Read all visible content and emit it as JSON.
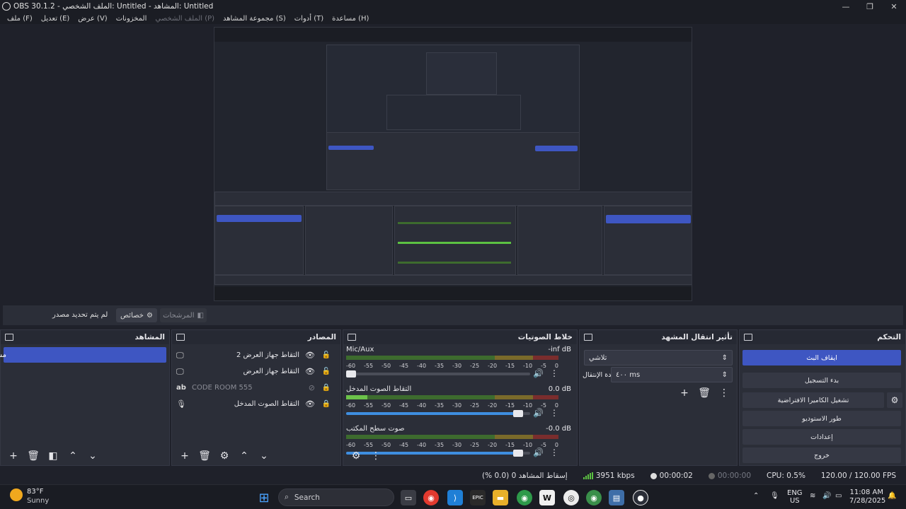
{
  "window": {
    "title": "OBS 30.1.2 - الملف الشخصي: Untitled - المشاهد: Untitled",
    "minimize": "—",
    "maximize": "❐",
    "close": "✕"
  },
  "menu": [
    {
      "label": "ملف (F)"
    },
    {
      "label": "تعديل (E)"
    },
    {
      "label": "عرض (V)"
    },
    {
      "label": "المخزونات"
    },
    {
      "label": "الملف الشخصي (P)",
      "disabled": true
    },
    {
      "label": "مجموعة المشاهد (S)"
    },
    {
      "label": "أدوات (T)"
    },
    {
      "label": "مساعدة (H)"
    }
  ],
  "source_toolbar": {
    "no_source": "لم يتم تحديد مصدر",
    "properties": "خصائص",
    "filters": "المرشحات"
  },
  "scenes": {
    "title": "المشاهد",
    "items": [
      "مشهد"
    ]
  },
  "sources": {
    "title": "المصادر",
    "items": [
      {
        "label": "التقاط جهاز العرض 2",
        "icon": "monitor-icon"
      },
      {
        "label": "التقاط جهاز العرض",
        "icon": "monitor-icon"
      },
      {
        "label": "CODE ROOM 555",
        "icon": "text-icon",
        "hidden": true
      },
      {
        "label": "التقاط الصوت المدخل",
        "icon": "microphone-icon"
      }
    ]
  },
  "mixer": {
    "title": "خلاط الصوتيات",
    "ticks": [
      "-60",
      "-55",
      "-50",
      "-45",
      "-40",
      "-35",
      "-30",
      "-25",
      "-20",
      "-15",
      "-10",
      "-5",
      "0"
    ],
    "channels": [
      {
        "name": "Mic/Aux",
        "db": "-inf dB",
        "level": 0.0,
        "volume": 0.02
      },
      {
        "name": "التقاط الصوت المدخل",
        "db": "0.0 dB",
        "level": 0.1,
        "volume": 0.96
      },
      {
        "name": "صوت سطح المكتب",
        "db": "-0.0 dB",
        "level": 0.0,
        "volume": 0.96
      }
    ]
  },
  "transitions": {
    "title": "تأثير انتقال المشهد",
    "selected": "تلاشي",
    "duration_label": "مدة الإنتقال",
    "duration_value": "٤٠٠ ms"
  },
  "controls": {
    "title": "التحكم",
    "stop_stream": "ايقاف البث",
    "start_record": "بدء التسجيل",
    "virtual_cam": "تشغيل الكاميرا الافتراضية",
    "studio_mode": "طور الاستوديو",
    "settings": "إعدادات",
    "exit": "خروج"
  },
  "status": {
    "dropped": "إسقاط المشاهد 0 (0.0 %)",
    "bitrate": "3951 kbps",
    "stream_time": "00:00:02",
    "record_time": "00:00:00",
    "cpu": "CPU: 0.5%",
    "fps": "120.00 / 120.00 FPS"
  },
  "taskbar": {
    "weather_temp": "83°F",
    "weather_desc": "Sunny",
    "search": "Search",
    "lang1": "ENG",
    "lang2": "US",
    "time": "11:08 AM",
    "date": "7/28/2025"
  }
}
